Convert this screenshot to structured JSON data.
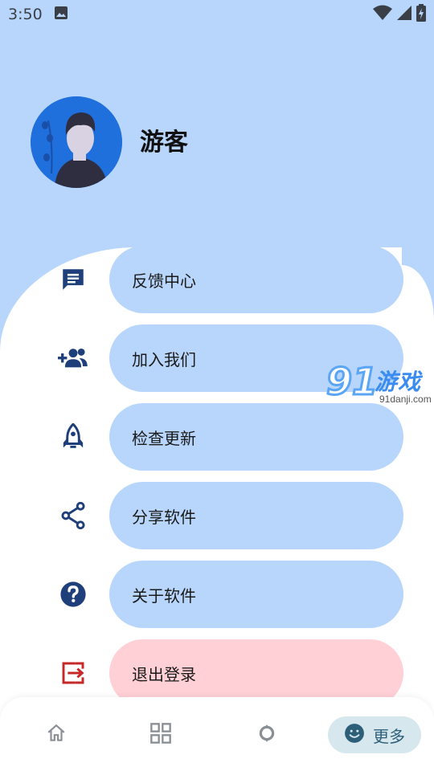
{
  "status_bar": {
    "time": "3:50",
    "icons": [
      "image-icon",
      "wifi-icon",
      "signal-icon",
      "battery-charging-icon"
    ]
  },
  "profile": {
    "username": "游客",
    "avatar": "user-avatar"
  },
  "menu": [
    {
      "label": "反馈中心",
      "icon": "feedback-icon"
    },
    {
      "label": "加入我们",
      "icon": "add-group-icon"
    },
    {
      "label": "检查更新",
      "icon": "rocket-icon"
    },
    {
      "label": "分享软件",
      "icon": "share-icon"
    },
    {
      "label": "关于软件",
      "icon": "help-icon"
    },
    {
      "label": "退出登录",
      "icon": "logout-icon"
    }
  ],
  "watermark": {
    "number": "91",
    "text": "游戏",
    "sub": "91danji.com"
  },
  "bottom_nav": {
    "items": [
      {
        "icon": "home-icon"
      },
      {
        "icon": "grid-icon"
      },
      {
        "icon": "discover-icon"
      },
      {
        "icon": "smile-icon",
        "label": "更多",
        "active": true
      }
    ]
  },
  "colors": {
    "primary_light": "#b8d6fc",
    "danger_light": "#ffd0d6",
    "icon_dark": "#1f3f7a",
    "danger": "#c62828"
  }
}
